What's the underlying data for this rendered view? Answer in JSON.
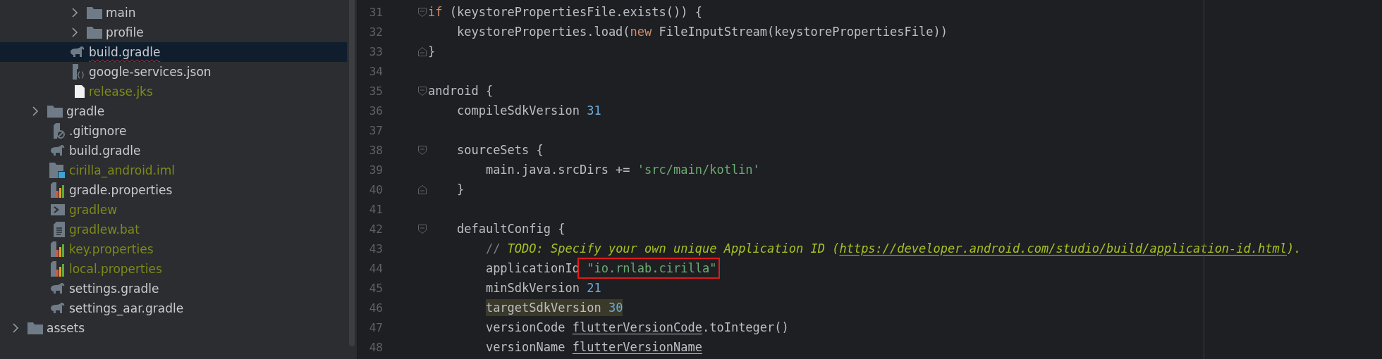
{
  "project_tree": [
    {
      "children": [
        {
          "children": [
            {
              "children": [
                {
                  "name": "main",
                  "kind": "folder",
                  "expanded": false,
                  "selected": false,
                  "untracked": false
                },
                {
                  "name": "profile",
                  "kind": "folder",
                  "expanded": false,
                  "selected": false,
                  "untracked": false
                }
              ]
            },
            {
              "name": "build.gradle",
              "kind": "gradle",
              "selected": true,
              "untracked": false,
              "error": true
            },
            {
              "name": "google-services.json",
              "kind": "json",
              "selected": false,
              "untracked": false
            },
            {
              "name": "release.jks",
              "kind": "blank",
              "selected": false,
              "untracked": true
            }
          ]
        },
        {
          "name": "gradle",
          "kind": "folder",
          "expanded": false,
          "selected": false,
          "untracked": false
        },
        {
          "name": ".gitignore",
          "kind": "ignore",
          "selected": false,
          "untracked": false
        },
        {
          "name": "build.gradle",
          "kind": "gradle",
          "selected": false,
          "untracked": false
        },
        {
          "name": "cirilla_android.iml",
          "kind": "module",
          "selected": false,
          "untracked": true
        },
        {
          "name": "gradle.properties",
          "kind": "properties",
          "selected": false,
          "untracked": false
        },
        {
          "name": "gradlew",
          "kind": "script",
          "selected": false,
          "untracked": true
        },
        {
          "name": "gradlew.bat",
          "kind": "text",
          "selected": false,
          "untracked": true
        },
        {
          "name": "key.properties",
          "kind": "properties",
          "selected": false,
          "untracked": true
        },
        {
          "name": "local.properties",
          "kind": "properties",
          "selected": false,
          "untracked": true
        },
        {
          "name": "settings.gradle",
          "kind": "gradle",
          "selected": false,
          "untracked": false
        },
        {
          "name": "settings_aar.gradle",
          "kind": "gradle",
          "selected": false,
          "untracked": false
        }
      ]
    },
    {
      "name": "assets",
      "kind": "folder",
      "expanded": false,
      "selected": false,
      "untracked": false
    }
  ],
  "editor": {
    "lines": [
      {
        "number": "31",
        "kind": "fold_start",
        "tokens": [
          {
            "kind": "keyword",
            "text": "if"
          },
          {
            "kind": "plain",
            "text": " (keystorePropertiesFile.exists()) {"
          }
        ]
      },
      {
        "number": "32",
        "tokens": [
          {
            "kind": "plain",
            "text": "    keystoreProperties.load("
          },
          {
            "kind": "keyword",
            "text": "new"
          },
          {
            "kind": "plain",
            "text": " FileInputStream(keystorePropertiesFile))"
          }
        ]
      },
      {
        "number": "33",
        "kind": "fold_end",
        "tokens": [
          {
            "kind": "plain",
            "text": "}"
          }
        ]
      },
      {
        "number": "34"
      },
      {
        "number": "35",
        "kind": "fold_start",
        "tokens": [
          {
            "kind": "plain",
            "text": "android {"
          }
        ]
      },
      {
        "number": "36",
        "tokens": [
          {
            "kind": "plain",
            "text": "    compileSdkVersion "
          },
          {
            "kind": "number",
            "text": "31"
          }
        ]
      },
      {
        "number": "37"
      },
      {
        "number": "38",
        "kind": "fold_start",
        "tokens": [
          {
            "kind": "plain",
            "text": "    sourceSets {"
          }
        ]
      },
      {
        "number": "39",
        "tokens": [
          {
            "kind": "plain",
            "text": "        main.java.srcDirs += "
          },
          {
            "kind": "string",
            "text": "'src/main/kotlin'"
          }
        ]
      },
      {
        "number": "40",
        "kind": "fold_end",
        "tokens": [
          {
            "kind": "plain",
            "text": "    }"
          }
        ]
      },
      {
        "number": "41"
      },
      {
        "number": "42",
        "kind": "fold_start",
        "tokens": [
          {
            "kind": "plain",
            "text": "    defaultConfig {"
          }
        ]
      },
      {
        "number": "43",
        "tokens": [
          {
            "kind": "comment",
            "text": "        // "
          },
          {
            "kind": "todo",
            "text": "TODO: Specify your own unique Application ID ("
          },
          {
            "kind": "link",
            "text": "https://developer.android.com/studio/build/application-id.html"
          },
          {
            "kind": "todo",
            "text": ")."
          }
        ]
      },
      {
        "number": "44",
        "tokens": [
          {
            "kind": "plain",
            "text": "        applicationId"
          },
          {
            "kind": "string",
            "text": " \"io.rnlab.cirilla\"",
            "boxed": true
          }
        ]
      },
      {
        "number": "45",
        "tokens": [
          {
            "kind": "plain",
            "text": "        minSdkVersion "
          },
          {
            "kind": "number",
            "text": "21"
          }
        ]
      },
      {
        "number": "46",
        "tokens": [
          {
            "kind": "plain",
            "text": "        targetSdkVersion ",
            "highlighted": true
          },
          {
            "kind": "number",
            "text": "30",
            "highlighted": true
          }
        ]
      },
      {
        "number": "47",
        "tokens": [
          {
            "kind": "plain",
            "text": "        versionCode "
          },
          {
            "kind": "field",
            "text": "flutterVersionCode"
          },
          {
            "kind": "plain",
            "text": ".toInteger()"
          }
        ]
      },
      {
        "number": "48",
        "tokens": [
          {
            "kind": "plain",
            "text": "        versionName "
          },
          {
            "kind": "field",
            "text": "flutterVersionName"
          }
        ]
      }
    ]
  }
}
